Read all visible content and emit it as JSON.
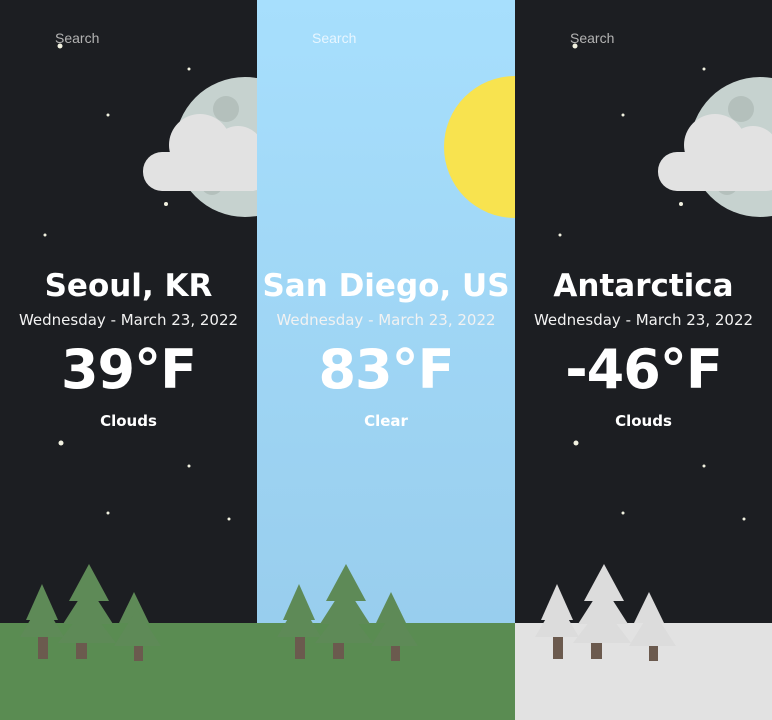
{
  "panels": [
    {
      "search_placeholder": "Search",
      "city": "Seoul, KR",
      "date": "Wednesday - March 23, 2022",
      "temperature": "39°F",
      "condition": "Clouds",
      "theme": "night",
      "icon": "moon-behind-cloud-icon",
      "ground_color": "#5a8c52"
    },
    {
      "search_placeholder": "Search",
      "city": "San Diego, US",
      "date": "Wednesday - March 23, 2022",
      "temperature": "83°F",
      "condition": "Clear",
      "theme": "day",
      "icon": "sun-icon",
      "ground_color": "#5a8c52"
    },
    {
      "search_placeholder": "Search",
      "city": "Antarctica",
      "date": "Wednesday - March 23, 2022",
      "temperature": "-46°F",
      "condition": "Clouds",
      "theme": "night",
      "icon": "moon-behind-cloud-icon",
      "ground_color": "#e2e2e2"
    }
  ],
  "colors": {
    "night_sky": "#1c1e22",
    "day_sky": "#a7dffd",
    "sun": "#f8e34f",
    "moon": "#c6d2cf",
    "cloud": "#e2e2e2",
    "grass": "#5a8c52",
    "snow": "#e2e2e2",
    "tree_green": "#5e8a57",
    "tree_snow": "#dcdcdc",
    "trunk": "#6b5a4e"
  }
}
